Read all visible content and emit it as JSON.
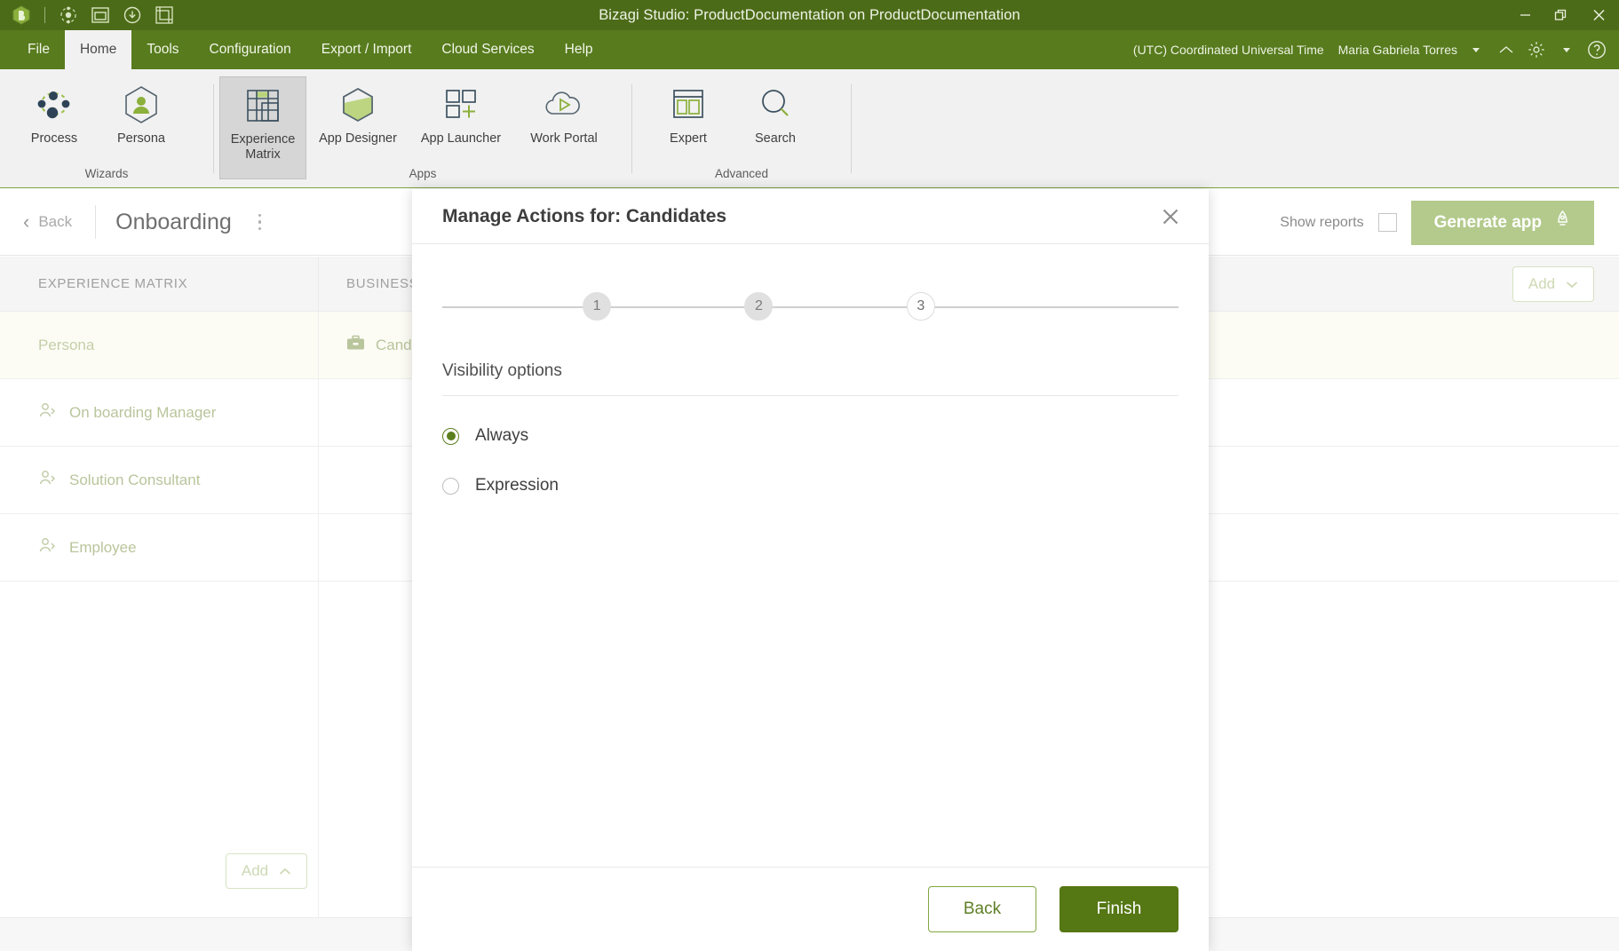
{
  "titlebar": {
    "title": "Bizagi Studio: ProductDocumentation  on  ProductDocumentation",
    "quick_icons": [
      "bizagi-logo-icon",
      "deploy-icon",
      "window-icon",
      "download-icon",
      "matrix-icon"
    ],
    "window_buttons": {
      "minimize": "—",
      "restore": "❐",
      "close": "✕"
    }
  },
  "menubar": {
    "items": [
      {
        "label": "File",
        "active": false
      },
      {
        "label": "Home",
        "active": true
      },
      {
        "label": "Tools",
        "active": false
      },
      {
        "label": "Configuration",
        "active": false
      },
      {
        "label": "Export / Import",
        "active": false
      },
      {
        "label": "Cloud Services",
        "active": false
      },
      {
        "label": "Help",
        "active": false
      }
    ],
    "timezone": "(UTC) Coordinated Universal Time",
    "user": "Maria Gabriela Torres",
    "user_caret": "▾",
    "icons": [
      "chevron-up-icon",
      "gear-icon",
      "caret-down-icon",
      "help-circle-icon"
    ]
  },
  "ribbon": {
    "groups": [
      {
        "label": "Wizards",
        "buttons": [
          {
            "label": "Process",
            "icon": "process-nodes-icon",
            "selected": false
          },
          {
            "label": "Persona",
            "icon": "persona-hexagon-icon",
            "selected": false
          }
        ]
      },
      {
        "label": "Apps",
        "buttons": [
          {
            "label": "Experience\nMatrix",
            "icon": "experience-matrix-icon",
            "selected": true
          },
          {
            "label": "App Designer",
            "icon": "app-designer-hexagon-icon",
            "selected": false
          },
          {
            "label": "App Launcher",
            "icon": "app-launcher-grid-icon",
            "selected": false
          },
          {
            "label": "Work Portal",
            "icon": "cloud-play-icon",
            "selected": false
          }
        ]
      },
      {
        "label": "Advanced",
        "buttons": [
          {
            "label": "Expert",
            "icon": "expert-panels-icon",
            "selected": false
          },
          {
            "label": "Search",
            "icon": "search-magnifier-icon",
            "selected": false
          }
        ]
      }
    ]
  },
  "matrix": {
    "back_label": "Back",
    "title": "Onboarding",
    "kebab": "more-options-icon",
    "show_reports_label": "Show reports",
    "show_reports_checked": false,
    "generate_app_label": "Generate app",
    "generate_app_icon": "rocket-icon",
    "columns": [
      "EXPERIENCE MATRIX",
      "BUSINESS"
    ],
    "persona_row": {
      "left": "Persona",
      "right": "Candidates",
      "right_icon": "briefcase-icon"
    },
    "rows": [
      {
        "label": "On boarding Manager",
        "icon": "person-arrow-icon"
      },
      {
        "label": "Solution Consultant",
        "icon": "person-arrow-icon"
      },
      {
        "label": "Employee",
        "icon": "person-arrow-icon"
      }
    ],
    "add_label": "Add",
    "add_caret_up": "chevron-up-icon",
    "add_caret_down": "chevron-down-icon"
  },
  "modal": {
    "title": "Manage Actions for: Candidates",
    "close_icon": "close-icon",
    "steps": [
      {
        "number": "1",
        "state": "done"
      },
      {
        "number": "2",
        "state": "done"
      },
      {
        "number": "3",
        "state": "current"
      }
    ],
    "section_title": "Visibility options",
    "options": [
      {
        "label": "Always",
        "selected": true
      },
      {
        "label": "Expression",
        "selected": false
      }
    ],
    "back_label": "Back",
    "finish_label": "Finish"
  },
  "colors": {
    "titlebar_green": "#4c6b18",
    "menubar_green": "#577b1d",
    "accent_green": "#557714",
    "radio_green": "#5b7f1f",
    "generate_btn": "#b3ca8c",
    "ribbon_bg": "#f1f1f1"
  }
}
